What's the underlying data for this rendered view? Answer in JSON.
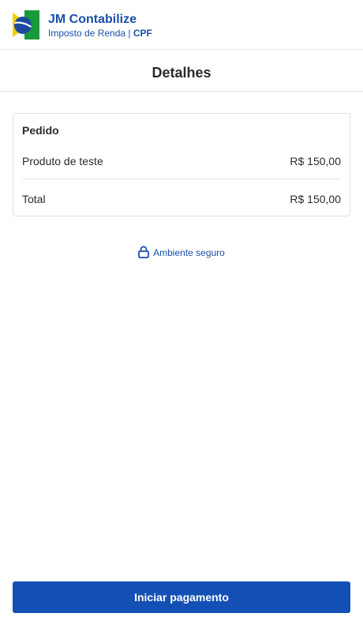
{
  "header": {
    "brand_name": "JM Contabilize",
    "subtitle": "Imposto de Renda",
    "separator": " | ",
    "subtitle_tag": "CPF",
    "logo_icon": "brazil-flag-icon"
  },
  "page": {
    "title": "Detalhes"
  },
  "order": {
    "title": "Pedido",
    "items": [
      {
        "label": "Produto de teste",
        "value": "R$ 150,00"
      }
    ],
    "total_label": "Total",
    "total_value": "R$ 150,00"
  },
  "security": {
    "label": "Ambiente seguro",
    "icon": "lock-icon"
  },
  "actions": {
    "pay_label": "Iniciar pagamento"
  },
  "colors": {
    "brand": "#1a4fa8",
    "button": "#1450b4",
    "flag_green": "#1a9a3a",
    "flag_yellow": "#f5d000"
  }
}
